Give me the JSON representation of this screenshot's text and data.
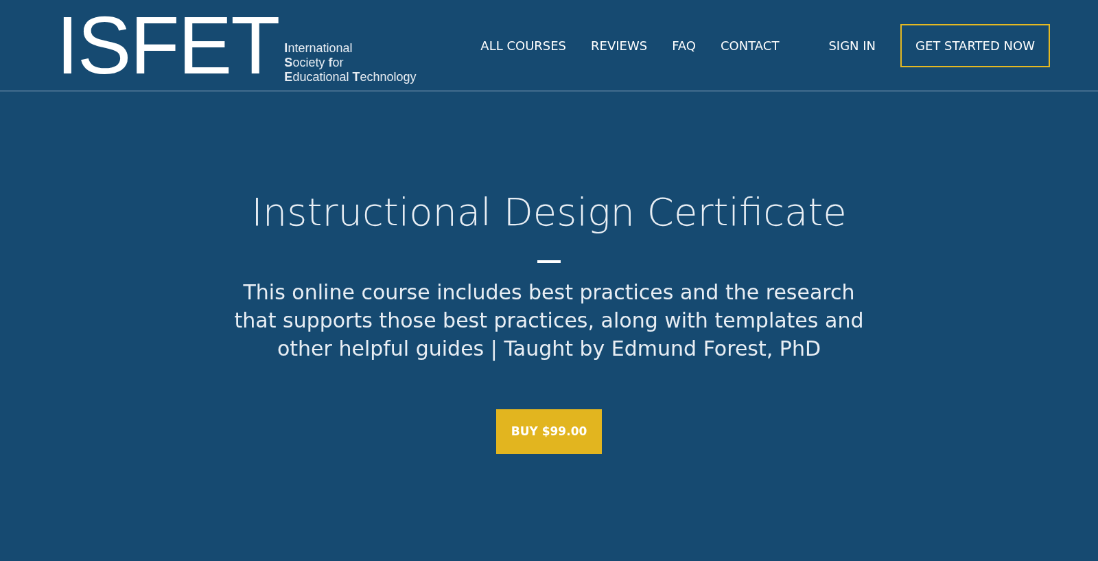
{
  "logo": {
    "mark": "ISFET",
    "tagline": [
      "**I**nternational",
      "**S**ociety **f**or",
      "**E**ducational **T**echnology"
    ]
  },
  "nav": {
    "links": [
      "ALL COURSES",
      "REVIEWS",
      "FAQ",
      "CONTACT"
    ],
    "sign_in": "SIGN IN",
    "cta": "GET STARTED NOW"
  },
  "hero": {
    "title": "Instructional Design Certificate",
    "description": "This online course includes best practices and the research that supports those best practices, along with templates and other helpful guides | Taught by Edmund Forest, PhD",
    "button": "BUY $99.00"
  }
}
